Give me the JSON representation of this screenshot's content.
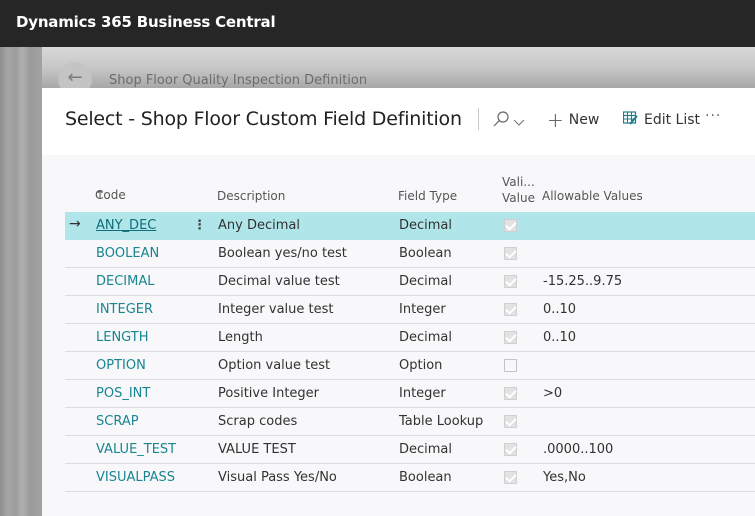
{
  "app": {
    "title": "Dynamics 365 Business Central"
  },
  "background_page": {
    "title": "Shop Floor Quality Inspection Definition",
    "back_icon": "back-arrow-icon"
  },
  "dialog": {
    "title": "Select - Shop Floor Custom Field Definition",
    "toolbar": {
      "search_icon": "search-icon",
      "search_chevron": "chevron-down-icon",
      "new_label": "New",
      "edit_list_label": "Edit List",
      "more_label": "···"
    }
  },
  "grid": {
    "columns": {
      "code": "Code",
      "code_sort": "↑",
      "description": "Description",
      "field_type": "Field Type",
      "validate_value_line1": "Vali...",
      "validate_value_line2": "Value",
      "allowable_values": "Allowable Values"
    },
    "rows": [
      {
        "code": "ANY_DEC",
        "description": "Any Decimal",
        "field_type": "Decimal",
        "validate": true,
        "allowable": "",
        "selected": true
      },
      {
        "code": "BOOLEAN",
        "description": "Boolean yes/no test",
        "field_type": "Boolean",
        "validate": true,
        "allowable": ""
      },
      {
        "code": "DECIMAL",
        "description": "Decimal value test",
        "field_type": "Decimal",
        "validate": true,
        "allowable": "-15.25..9.75"
      },
      {
        "code": "INTEGER",
        "description": "Integer value test",
        "field_type": "Integer",
        "validate": true,
        "allowable": "0..10"
      },
      {
        "code": "LENGTH",
        "description": "Length",
        "field_type": "Decimal",
        "validate": true,
        "allowable": "0..10"
      },
      {
        "code": "OPTION",
        "description": "Option value test",
        "field_type": "Option",
        "validate": false,
        "allowable": ""
      },
      {
        "code": "POS_INT",
        "description": "Positive Integer",
        "field_type": "Integer",
        "validate": true,
        "allowable": ">0"
      },
      {
        "code": "SCRAP",
        "description": "Scrap codes",
        "field_type": "Table Lookup",
        "validate": true,
        "allowable": ""
      },
      {
        "code": "VALUE_TEST",
        "description": "VALUE TEST",
        "field_type": "Decimal",
        "validate": true,
        "allowable": ".0000..100"
      },
      {
        "code": "VISUALPASS",
        "description": "Visual Pass Yes/No",
        "field_type": "Boolean",
        "validate": true,
        "allowable": "Yes,No"
      }
    ]
  },
  "colors": {
    "accent": "#188590",
    "selected_row": "#b0e6ea",
    "topbar": "#262626"
  }
}
